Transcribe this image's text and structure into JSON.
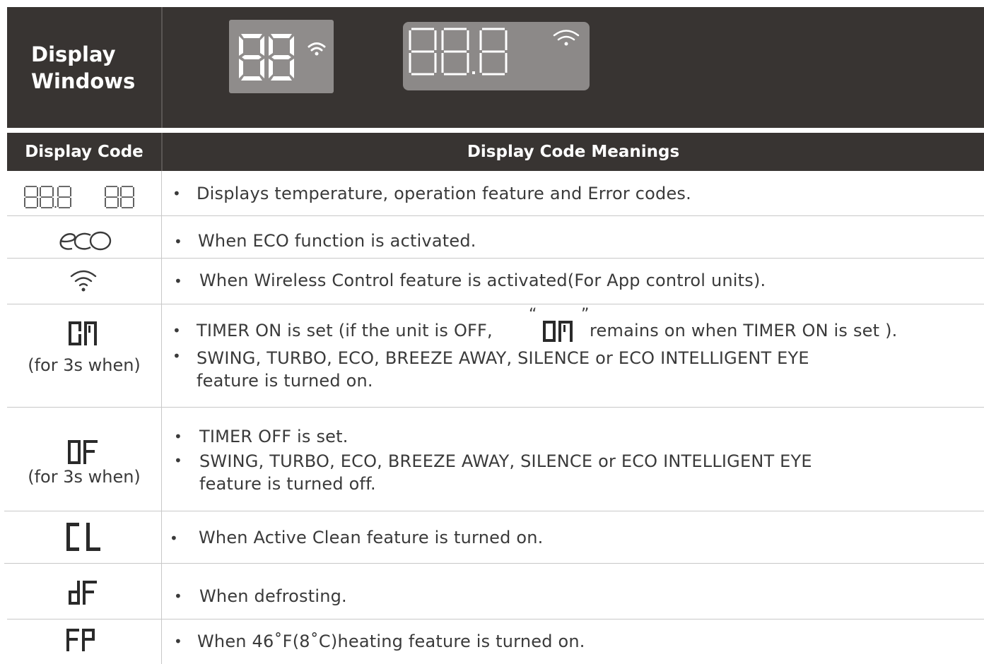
{
  "header": {
    "title": "Display Windows",
    "lcd_small": "88",
    "lcd_large": "88.8"
  },
  "table": {
    "col1_header": "Display Code",
    "col2_header": "Display Code Meanings",
    "rows": [
      {
        "code": "88.8  88",
        "icon": "segment-88-icon",
        "meanings": [
          "Displays  temperature, operation feature and Error codes."
        ]
      },
      {
        "code": "eco",
        "icon": "eco-icon",
        "meanings": [
          "When ECO function is activated."
        ]
      },
      {
        "code": "wifi",
        "icon": "wifi-icon",
        "meanings": [
          "When Wireless Control feature is activated(For App control units)."
        ]
      },
      {
        "code": "On",
        "icon": "segment-on-icon",
        "sub": "(for 3s when)",
        "meanings": [
          "TIMER ON is set (if the unit is OFF,",
          "remains on when TIMER ON is set ).",
          "SWING, TURBO, ECO, BREEZE AWAY, SILENCE or ECO INTELLIGENT EYE",
          "feature is turned on."
        ],
        "quote_open": "“",
        "quote_close": "”"
      },
      {
        "code": "OF",
        "icon": "segment-of-icon",
        "sub": "(for 3s when)",
        "meanings": [
          "TIMER OFF is set.",
          "SWING, TURBO, ECO, BREEZE AWAY, SILENCE or ECO INTELLIGENT EYE",
          "feature is turned off."
        ]
      },
      {
        "code": "CL",
        "icon": "segment-cl-icon",
        "meanings": [
          "When Active Clean feature is turned on."
        ]
      },
      {
        "code": "dF",
        "icon": "segment-df-icon",
        "meanings": [
          "When defrosting."
        ]
      },
      {
        "code": "FP",
        "icon": "segment-fp-icon",
        "meanings": [
          "When 46˚F(8˚C)heating feature is turned on."
        ]
      }
    ]
  },
  "colors": {
    "header_bg": "#383432",
    "lcd_bg": "#8f8c8b",
    "segment_white": "#ffffff",
    "text": "#3a3a3a",
    "grid": "#c8c8c8"
  }
}
